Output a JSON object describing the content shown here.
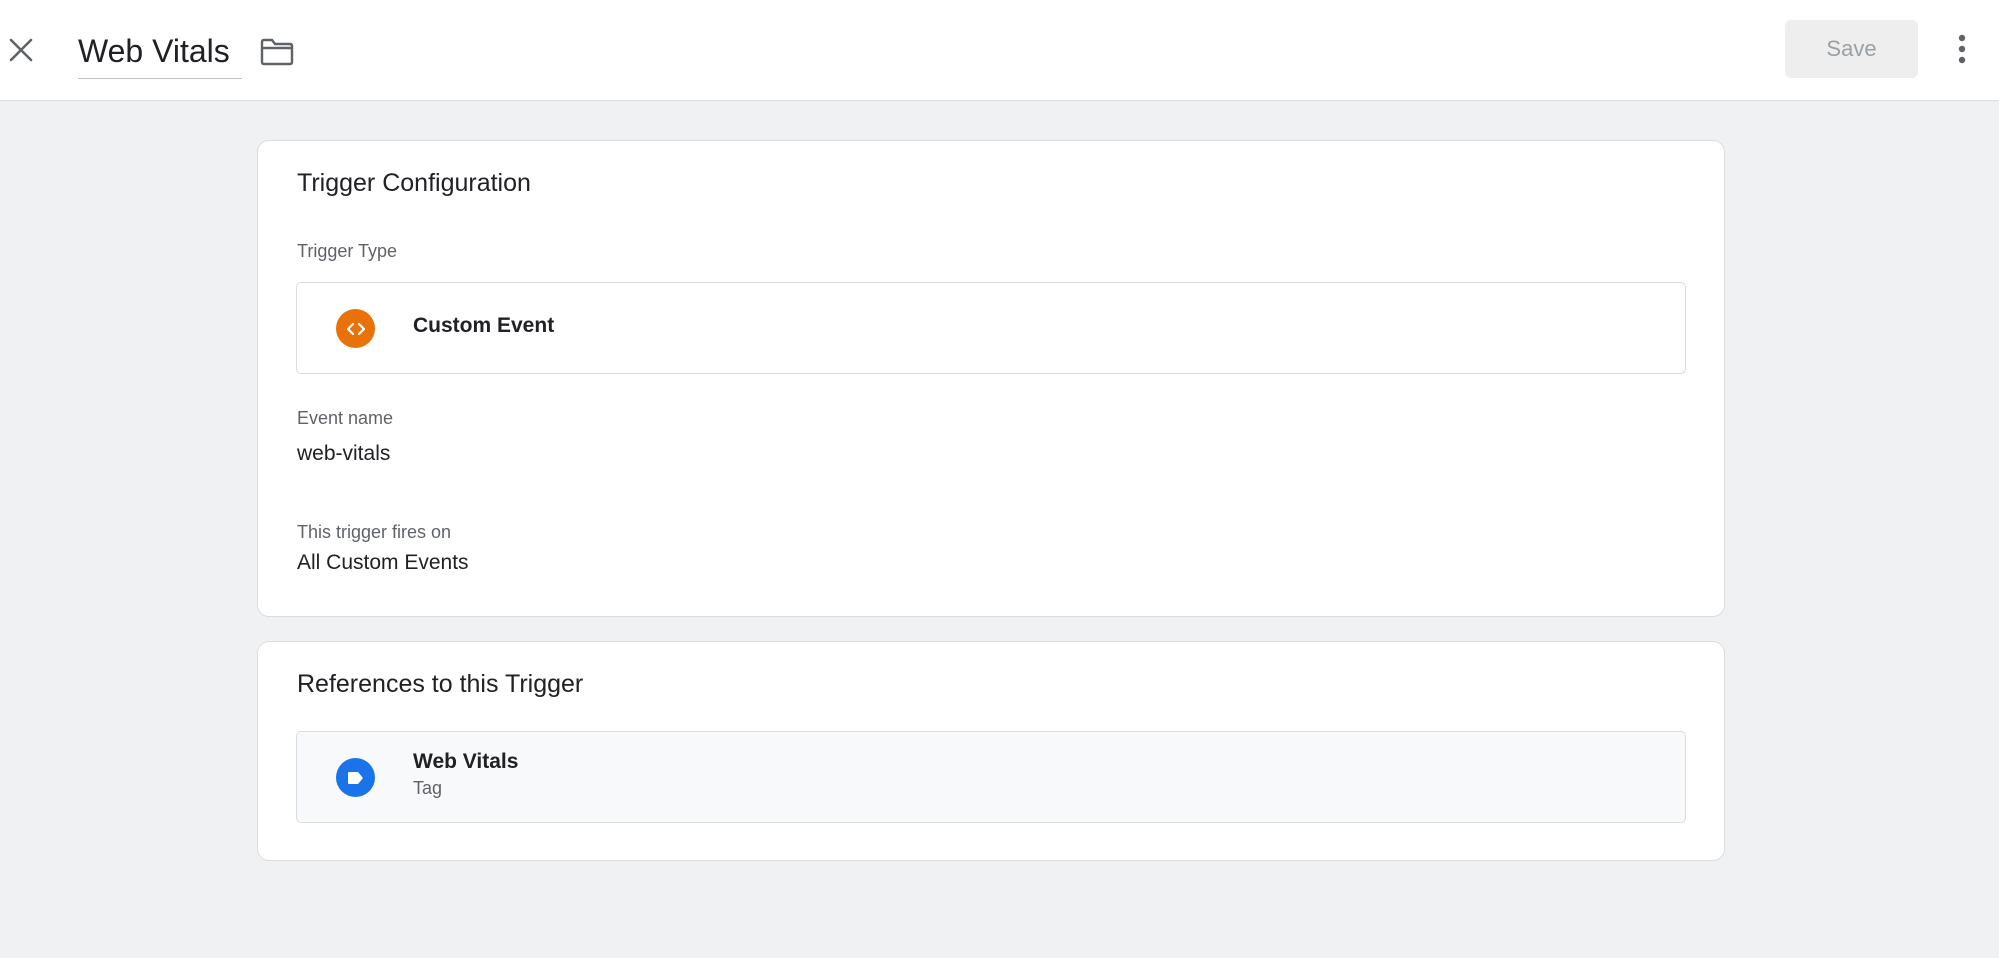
{
  "header": {
    "title": "Web Vitals",
    "save_label": "Save",
    "close_icon": "close-icon",
    "folder_icon": "folder-icon",
    "more_icon": "more-vert-icon"
  },
  "trigger_configuration": {
    "heading": "Trigger Configuration",
    "trigger_type_label": "Trigger Type",
    "trigger_type": {
      "name": "Custom Event",
      "icon": "code-brackets-icon",
      "icon_color": "#e8710a"
    },
    "event_name_label": "Event name",
    "event_name": "web-vitals",
    "fires_on_label": "This trigger fires on",
    "fires_on": "All Custom Events"
  },
  "references": {
    "heading": "References to this Trigger",
    "items": [
      {
        "name": "Web Vitals",
        "type": "Tag",
        "icon": "tag-icon",
        "icon_color": "#1a73e8"
      }
    ]
  },
  "colors": {
    "page_background": "#f0f1f3",
    "card_background": "#ffffff",
    "border": "#dadce0",
    "save_disabled_bg": "#eeeeee"
  }
}
